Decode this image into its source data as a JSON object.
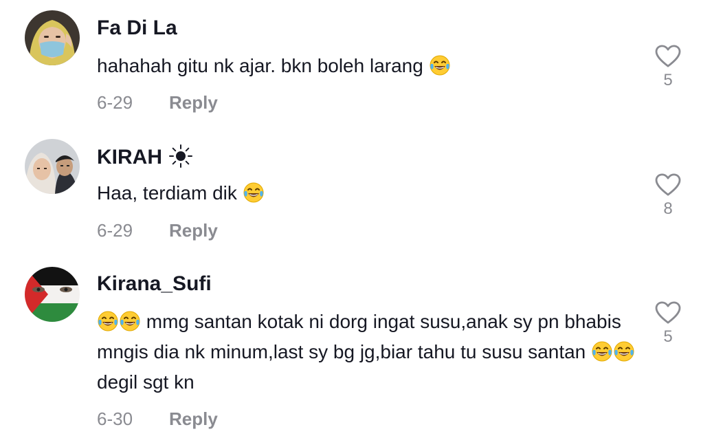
{
  "comments": [
    {
      "username": "Fa Di La",
      "text": "hahahah gitu nk ajar. bkn boleh larang",
      "date": "6-29",
      "reply_label": "Reply",
      "likes": "5",
      "emojis": [
        "face-with-tears-of-joy"
      ]
    },
    {
      "username": "KIRAH",
      "username_icon": "sun-icon",
      "text": "Haa, terdiam dik",
      "date": "6-29",
      "reply_label": "Reply",
      "likes": "8",
      "emojis": [
        "face-with-tears-of-joy"
      ]
    },
    {
      "username": "Kirana_Sufi",
      "text_part1": "mmg santan kotak ni dorg ingat susu,anak sy pn bhabis mngis dia nk minum,last sy bg jg,biar tahu tu susu santan",
      "text_part2": "degil sgt kn",
      "date": "6-30",
      "reply_label": "Reply",
      "likes": "5",
      "emojis": [
        "face-with-tears-of-joy",
        "face-with-tears-of-joy"
      ]
    }
  ],
  "colors": {
    "text_primary": "#161823",
    "text_secondary": "#8a8b91",
    "background": "#ffffff"
  }
}
